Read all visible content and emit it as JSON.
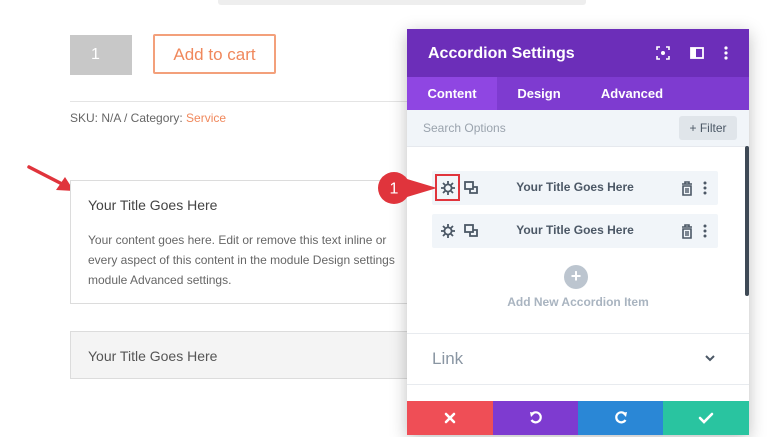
{
  "product": {
    "quantity": "1",
    "add_to_cart": "Add to cart",
    "sku_prefix": "SKU: N/A / Category: ",
    "category": "Service"
  },
  "preview_accordion": {
    "open_title": "Your Title Goes Here",
    "open_content": "Your content goes here. Edit or remove this text inline or every aspect of this content in the module Design settings module Advanced settings.",
    "closed_title": "Your Title Goes Here"
  },
  "settings_panel": {
    "title": "Accordion Settings",
    "tabs": [
      {
        "label": "Content",
        "active": true
      },
      {
        "label": "Design",
        "active": false
      },
      {
        "label": "Advanced",
        "active": false
      }
    ],
    "search_placeholder": "Search Options",
    "filter_label": "+ Filter",
    "items": [
      {
        "label": "Your Title Goes Here",
        "highlighted": true
      },
      {
        "label": "Your Title Goes Here",
        "highlighted": false
      }
    ],
    "add_item_label": "Add New Accordion Item",
    "add_icon": "+",
    "link_section": "Link",
    "callout_number": "1"
  },
  "colors": {
    "header": "#6c2eb9",
    "tabs": "#7e3bd0",
    "active_tab": "#8f46e2",
    "accent_orange": "#f0885c",
    "callout_red": "#e0343c",
    "footer_cancel": "#ef4e56",
    "footer_undo": "#7e3bd0",
    "footer_redo": "#2a87d6",
    "footer_save": "#29c4a0"
  },
  "icons": [
    "focus-icon",
    "split-view-icon",
    "more-options-icon",
    "gear-icon",
    "duplicate-icon",
    "trash-icon",
    "kebab-icon",
    "add-icon",
    "chevron-down-icon",
    "close-icon",
    "undo-icon",
    "redo-icon",
    "check-icon"
  ]
}
